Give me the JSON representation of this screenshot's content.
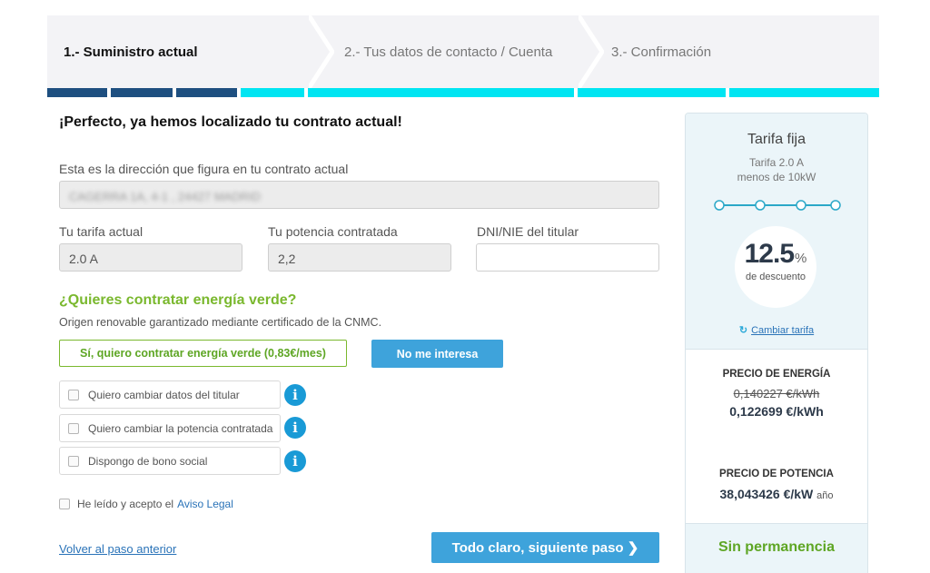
{
  "steps": [
    {
      "label": "1.- Suministro actual"
    },
    {
      "label": "2.- Tus datos de contacto / Cuenta"
    },
    {
      "label": "3.- Confirmación"
    }
  ],
  "progress_colors": {
    "done": "#1e4f80",
    "pending": "#00e5f2"
  },
  "form": {
    "title": "¡Perfecto, ya hemos localizado tu contrato actual!",
    "address_label": "Esta es la dirección que figura en tu contrato actual",
    "address_value": "CAGERRA 1A, 4-1 , 24427 MADRID",
    "tariff_label": "Tu tarifa actual",
    "tariff_value": "2.0 A",
    "power_label": "Tu potencia contratada",
    "power_value": "2,2",
    "dni_label": "DNI/NIE del titular",
    "dni_value": ""
  },
  "green_energy": {
    "title": "¿Quieres contratar energía verde?",
    "subtitle": "Origen renovable garantizado mediante certificado de la CNMC.",
    "yes_label": "Sí, quiero contratar energía verde (0,83€/mes)",
    "no_label": "No me interesa"
  },
  "options": [
    {
      "label": "Quiero cambiar datos del titular"
    },
    {
      "label": "Quiero cambiar la potencia contratada"
    },
    {
      "label": "Dispongo de bono social"
    }
  ],
  "legal": {
    "text": "He leído y acepto el",
    "link": "Aviso Legal"
  },
  "nav": {
    "back": "Volver al paso anterior",
    "next": "Todo claro, siguiente paso ❯"
  },
  "sidebar": {
    "tariff_name": "Tarifa fija",
    "tariff_desc_1": "Tarifa 2.0 A",
    "tariff_desc_2": "menos de 10kW",
    "discount_value": "12.5",
    "discount_unit": "%",
    "discount_label": "de descuento",
    "change_tariff": "Cambiar tarifa",
    "energy_title": "PRECIO DE ENERGÍA",
    "energy_old": "0,140227 €/kWh",
    "energy_new": "0,122699 €/kWh",
    "power_title": "PRECIO DE POTENCIA",
    "power_value": "38,043426 €/kW",
    "power_unit": "año",
    "no_commitment": "Sin permanencia"
  }
}
